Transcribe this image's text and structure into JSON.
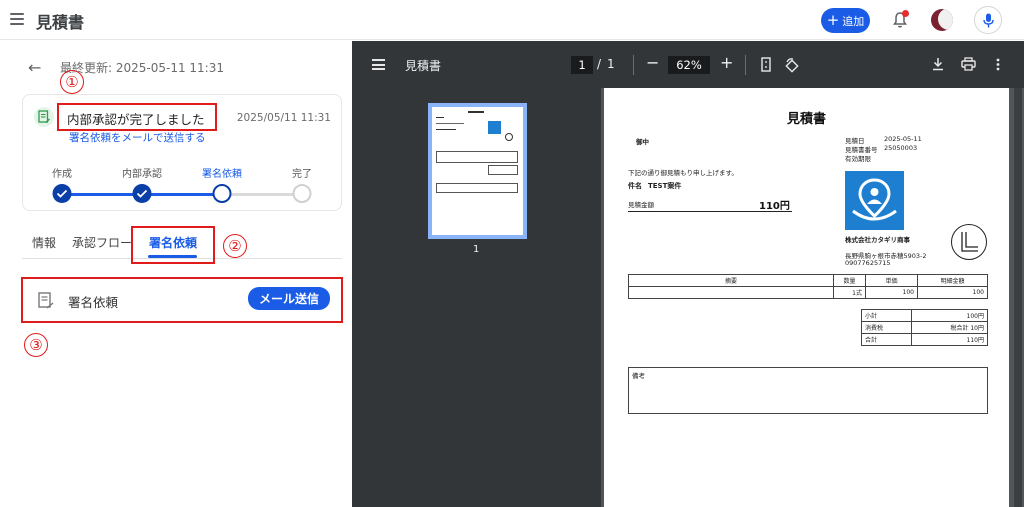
{
  "app": {
    "title": "見積書"
  },
  "header": {
    "add_label": "追加",
    "icons": [
      "menu-icon",
      "plus-icon",
      "bell-icon",
      "avatar",
      "mic-icon"
    ],
    "notification_dot_color": "#e52d2d",
    "accent": "#1a5ce6"
  },
  "panel": {
    "last_updated": "最終更新: 2025-05-11 11:31",
    "status": {
      "title": "内部承認が完了しました",
      "date": "2025/05/11 11:31",
      "link": "署名依頼をメールで送信する"
    },
    "steps": [
      {
        "label": "作成",
        "state": "done"
      },
      {
        "label": "内部承認",
        "state": "done"
      },
      {
        "label": "署名依頼",
        "state": "current"
      },
      {
        "label": "完了",
        "state": "todo"
      }
    ],
    "tabs": [
      {
        "label": "情報",
        "active": false
      },
      {
        "label": "承認フロー",
        "active": false
      },
      {
        "label": "署名依頼",
        "active": true
      }
    ],
    "sign_request": {
      "label": "署名依頼",
      "button": "メール送信"
    }
  },
  "annotations": [
    "①",
    "②",
    "③"
  ],
  "viewer": {
    "title": "見積書",
    "page_current": "1",
    "page_separator": "/",
    "page_total": "1",
    "zoom": "62%",
    "thumbnail_label": "1",
    "icons": [
      "menu-icon",
      "fit-page-icon",
      "rotate-icon",
      "download-icon",
      "print-icon",
      "more-icon"
    ]
  },
  "document": {
    "title": "見積書",
    "recipient": "御中",
    "meta": [
      {
        "label": "見積日",
        "value": "2025-05-11"
      },
      {
        "label": "見積書番号",
        "value": "25050003"
      },
      {
        "label": "有効期限",
        "value": ""
      }
    ],
    "intro": "下記の通り御見積もり申し上げます。",
    "subject_label": "件名",
    "subject": "TEST案件",
    "amount_label": "見積金額",
    "amount": "110円",
    "company": "株式会社カタギリ商事",
    "address": "長野県駒ヶ根市赤穂5903-2",
    "phone": "09077625715",
    "items_header": [
      "摘要",
      "数量",
      "単価",
      "明細金額"
    ],
    "items": [
      {
        "desc": "",
        "qty": "1式",
        "price": "100",
        "total": "100"
      }
    ],
    "totals": [
      {
        "label": "小計",
        "value": "100円"
      },
      {
        "label": "消費税",
        "value": "税合計 10円"
      },
      {
        "label": "合計",
        "value": "110円"
      }
    ],
    "notes_label": "備考"
  }
}
